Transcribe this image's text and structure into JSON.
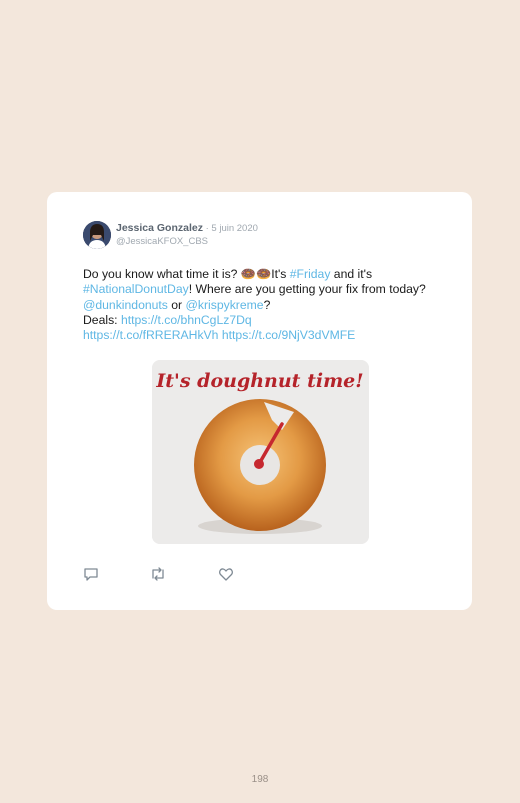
{
  "tweet": {
    "author_name": "Jessica Gonzalez",
    "date": "5 juin 2020",
    "separator": " · ",
    "handle": "@JessicaKFOX_CBS",
    "text": {
      "p1": "Do you know what time it is? ",
      "emoji": "🍩🍩",
      "p2": "It's ",
      "tag_friday": "#Friday",
      "p3": " and it's ",
      "tag_national": "#NationalDonutDay",
      "p4": "! Where are you getting your fix from today? ",
      "mention_dunkin": "@dunkindonuts",
      "p5": " or ",
      "mention_krispy": "@krispykreme",
      "p6": "?",
      "deals_label": "Deals: ",
      "link1": "https://t.co/bhnCgLz7Dq",
      "link2": "https://t.co/fRRERAHkVh",
      "link3": "https://t.co/9NjV3dVMFE"
    },
    "image_caption": "It's doughnut time!"
  },
  "page_number": "198",
  "icons": [
    "reply-icon",
    "retweet-icon",
    "like-icon"
  ],
  "colors": {
    "background": "#f3e7dc",
    "card": "#ffffff",
    "link": "#5fb7e4",
    "caption": "#b5232a"
  }
}
